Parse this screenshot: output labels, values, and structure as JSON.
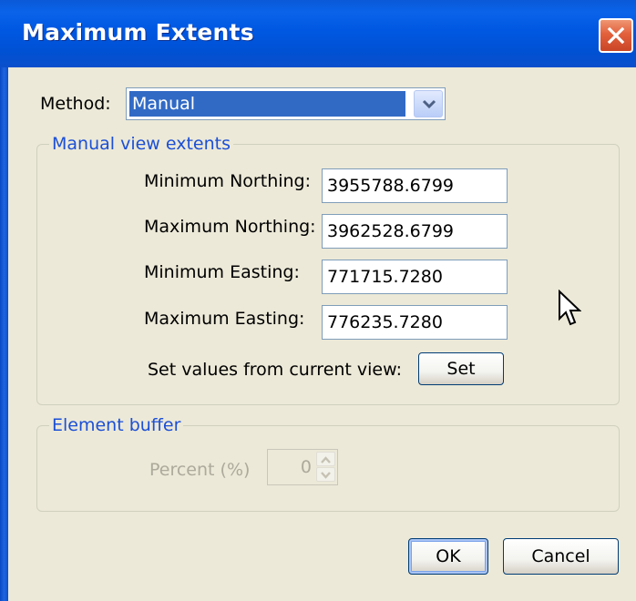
{
  "window": {
    "title": "Maximum Extents"
  },
  "method": {
    "label": "Method:",
    "value": "Manual"
  },
  "manual_extents": {
    "legend": "Manual view extents",
    "fields": [
      {
        "label": "Minimum Northing:",
        "value": "3955788.6799"
      },
      {
        "label": "Maximum Northing:",
        "value": "3962528.6799"
      },
      {
        "label": "Minimum Easting:",
        "value": "771715.7280"
      },
      {
        "label": "Maximum Easting:",
        "value": "776235.7280"
      }
    ],
    "set_label": "Set values from current view:",
    "set_button": "Set"
  },
  "element_buffer": {
    "legend": "Element buffer",
    "percent_label": "Percent (%)",
    "percent_value": "0"
  },
  "buttons": {
    "ok": "OK",
    "cancel": "Cancel"
  },
  "icons": {
    "close": "close-icon",
    "dropdown": "chevron-down-icon",
    "spin_up": "spin-up-icon",
    "spin_down": "spin-down-icon",
    "cursor": "mouse-cursor-icon"
  }
}
